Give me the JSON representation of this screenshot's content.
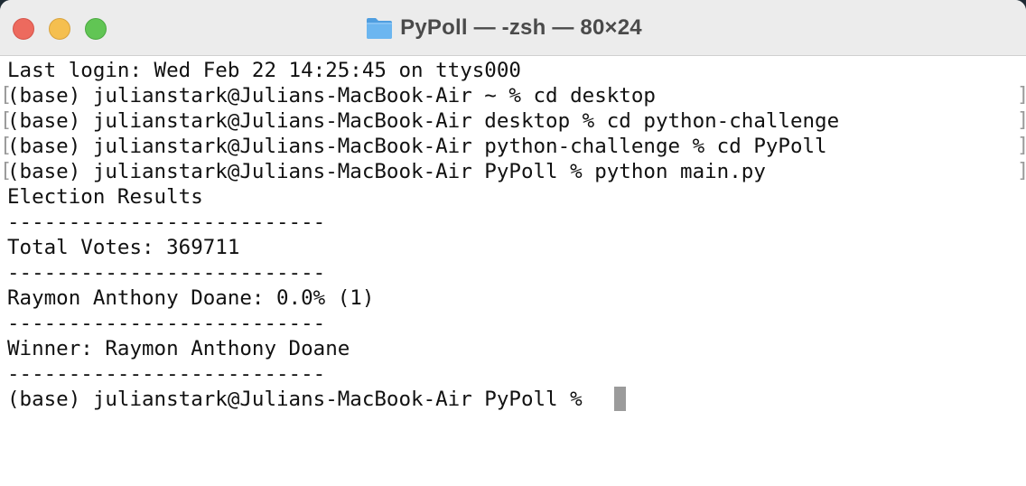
{
  "window": {
    "title": "PyPoll — -zsh — 80×24",
    "buttons": {
      "close": "close",
      "minimize": "minimize",
      "maximize": "maximize"
    },
    "title_icon": "folder-icon",
    "colors": {
      "close": "#ed6a5e",
      "minimize": "#f5bf4f",
      "maximize": "#61c554",
      "folder": "#5aa7e6"
    }
  },
  "terminal": {
    "lines": [
      "Last login: Wed Feb 22 14:25:45 on ttys000",
      "(base) julianstark@Julians-MacBook-Air ~ % cd desktop",
      "(base) julianstark@Julians-MacBook-Air desktop % cd python-challenge",
      "(base) julianstark@Julians-MacBook-Air python-challenge % cd PyPoll",
      "(base) julianstark@Julians-MacBook-Air PyPoll % python main.py",
      "Election Results",
      "--------------------------",
      "Total Votes: 369711",
      "--------------------------",
      "Raymon Anthony Doane: 0.0% (1)",
      "--------------------------",
      "Winner: Raymon Anthony Doane",
      "--------------------------",
      "(base) julianstark@Julians-MacBook-Air PyPoll % "
    ],
    "marks": [
      "[",
      "]"
    ]
  }
}
